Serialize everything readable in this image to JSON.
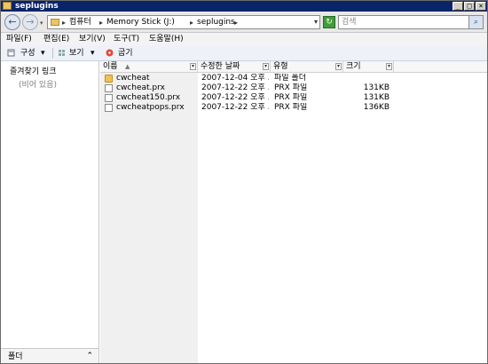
{
  "window": {
    "title": "seplugins",
    "colors": {
      "titlebar": "#0a246a",
      "folder": "#f1c24f"
    }
  },
  "address": {
    "crumbs": [
      "컴퓨터",
      "Memory Stick (J:)",
      "seplugins"
    ],
    "search_placeholder": "검색"
  },
  "menu": [
    "파일(F)",
    "편집(E)",
    "보기(V)",
    "도구(T)",
    "도움말(H)"
  ],
  "toolbar": {
    "organize": "구성",
    "views": "보기",
    "burn": "굽기"
  },
  "navpane": {
    "favorites": "즐겨찾기 링크",
    "empty": "(비어 있음)",
    "folders": "폴더"
  },
  "columns": {
    "name": "이름",
    "modified": "수정한 날짜",
    "type": "유형",
    "size": "크기"
  },
  "files": [
    {
      "name": "cwcheat",
      "modified": "2007-12-04 오후 ...",
      "type": "파일 폴더",
      "size": "",
      "icon": "folder-icon"
    },
    {
      "name": "cwcheat.prx",
      "modified": "2007-12-22 오후 ...",
      "type": "PRX 파일",
      "size": "131KB",
      "icon": "file-icon"
    },
    {
      "name": "cwcheat150.prx",
      "modified": "2007-12-22 오후 ...",
      "type": "PRX 파일",
      "size": "131KB",
      "icon": "file-icon"
    },
    {
      "name": "cwcheatpops.prx",
      "modified": "2007-12-22 오후 ...",
      "type": "PRX 파일",
      "size": "136KB",
      "icon": "file-icon"
    }
  ]
}
